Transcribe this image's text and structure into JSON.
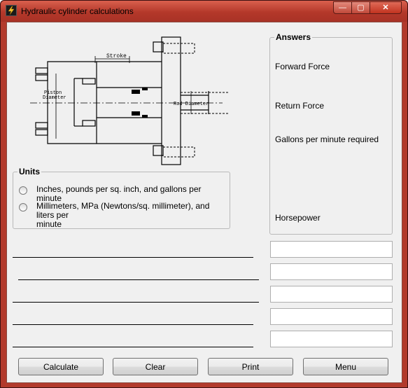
{
  "window": {
    "title": "Hydraulic cylinder calculations",
    "controls": {
      "minimize": "—",
      "maximize": "▢",
      "close": "✕"
    }
  },
  "diagram": {
    "stroke_label": "Stroke",
    "piston_label_1": "Piston",
    "piston_label_2": "Diameter",
    "rod_label": "Rod Diameter"
  },
  "units": {
    "title": "Units",
    "options": [
      {
        "label_line1": "Inches, pounds per sq. inch, and gallons per minute",
        "label_line2": "",
        "selected": false
      },
      {
        "label_line1": "Millimeters, MPa (Newtons/sq. millimeter), and liters per",
        "label_line2": "minute",
        "selected": false
      }
    ]
  },
  "answers": {
    "title": "Answers",
    "labels": [
      "Forward Force",
      "Return Force",
      "Gallons per minute required",
      "Horsepower"
    ]
  },
  "inputs": [
    {
      "value": ""
    },
    {
      "value": ""
    },
    {
      "value": ""
    },
    {
      "value": ""
    },
    {
      "value": ""
    }
  ],
  "buttons": {
    "calculate": "Calculate",
    "clear": "Clear",
    "print": "Print",
    "menu": "Menu"
  }
}
